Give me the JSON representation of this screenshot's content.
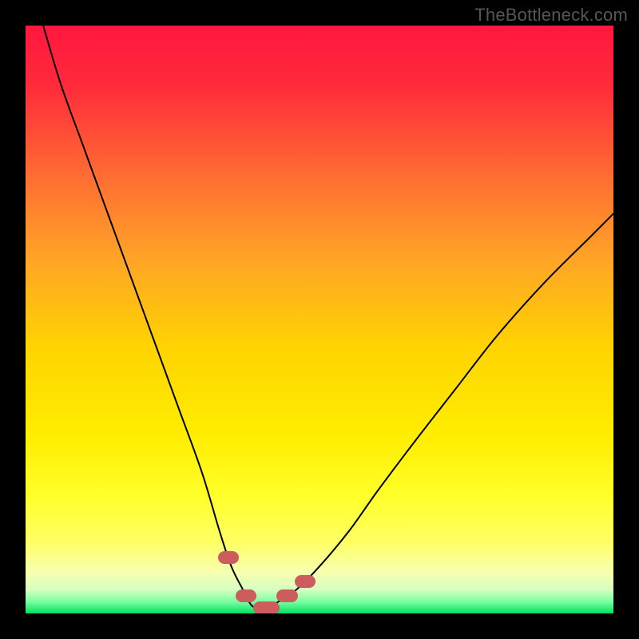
{
  "watermark": "TheBottleneck.com",
  "colors": {
    "frame_bg": "#000000",
    "gradient_top": "#ff173f",
    "gradient_mid1": "#ff7a33",
    "gradient_mid2": "#ffd400",
    "gradient_mid3": "#ffff2a",
    "gradient_low": "#f7ffb0",
    "gradient_green": "#00e060",
    "curve": "#000000",
    "bump": "#cd5c5c",
    "watermark": "#565656"
  },
  "chart_data": {
    "type": "line",
    "title": "",
    "xlabel": "",
    "ylabel": "",
    "xlim": [
      0,
      100
    ],
    "ylim": [
      0,
      100
    ],
    "series": [
      {
        "name": "bottleneck-curve",
        "x": [
          3,
          6,
          10,
          14,
          18,
          22,
          26,
          30,
          33,
          35,
          37,
          38,
          39,
          41,
          43,
          46,
          50,
          55,
          60,
          66,
          73,
          80,
          88,
          96,
          100
        ],
        "y": [
          100,
          90,
          79,
          68,
          57,
          46,
          35,
          24,
          14,
          8,
          4,
          2,
          1,
          1,
          2,
          4,
          8,
          14,
          21,
          29,
          38,
          47,
          56,
          64,
          68
        ]
      }
    ],
    "highlight_segments_x": [
      {
        "from": 33,
        "to": 36
      },
      {
        "from": 36,
        "to": 39
      },
      {
        "from": 39,
        "to": 43
      },
      {
        "from": 43,
        "to": 46
      },
      {
        "from": 46,
        "to": 49
      }
    ],
    "annotations": []
  }
}
